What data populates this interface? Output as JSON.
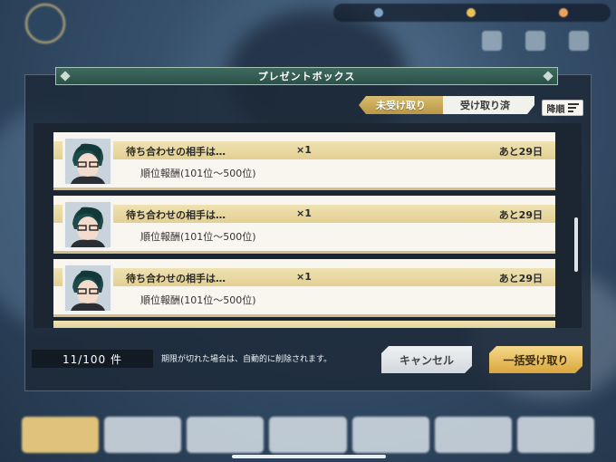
{
  "dialog": {
    "title": "プレゼントボックス",
    "tabs": [
      {
        "label": "未受け取り",
        "active": true
      },
      {
        "label": "受け取り済",
        "active": false
      }
    ],
    "sort_label": "降順",
    "items": [
      {
        "name": "待ち合わせの相手は…",
        "quantity": "×1",
        "expires": "あと29日",
        "description": "順位報酬(101位～500位)"
      },
      {
        "name": "待ち合わせの相手は…",
        "quantity": "×1",
        "expires": "あと29日",
        "description": "順位報酬(101位～500位)"
      },
      {
        "name": "待ち合わせの相手は…",
        "quantity": "×1",
        "expires": "あと29日",
        "description": "順位報酬(101位～500位)"
      }
    ],
    "count": "11/100 件",
    "notice": "期限が切れた場合は、自動的に削除されます。",
    "cancel_label": "キャンセル",
    "receive_all_label": "一括受け取り"
  },
  "colors": {
    "accent_gold": "#d9bd6e",
    "title_green": "#3d6a60",
    "card_band": "#e2cf92",
    "panel_dark": "#1c2532"
  },
  "icons": {
    "item_thumbnail": "character-portrait-icon",
    "sort": "sort-descending-icon"
  }
}
